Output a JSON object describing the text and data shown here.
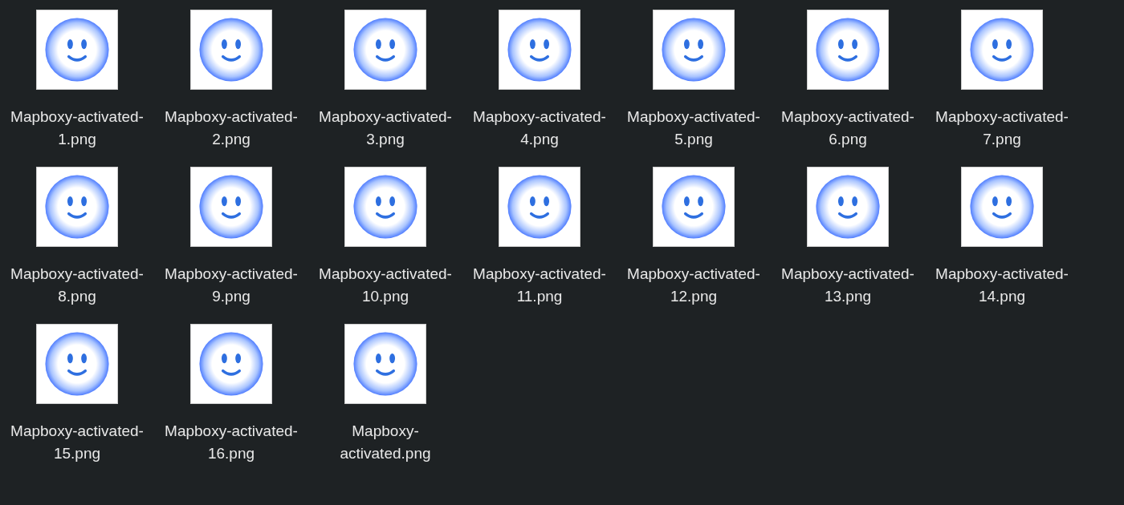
{
  "files": [
    {
      "name": "Mapboxy-activated-1.png"
    },
    {
      "name": "Mapboxy-activated-2.png"
    },
    {
      "name": "Mapboxy-activated-3.png"
    },
    {
      "name": "Mapboxy-activated-4.png"
    },
    {
      "name": "Mapboxy-activated-5.png"
    },
    {
      "name": "Mapboxy-activated-6.png"
    },
    {
      "name": "Mapboxy-activated-7.png"
    },
    {
      "name": "Mapboxy-activated-8.png"
    },
    {
      "name": "Mapboxy-activated-9.png"
    },
    {
      "name": "Mapboxy-activated-10.png"
    },
    {
      "name": "Mapboxy-activated-11.png"
    },
    {
      "name": "Mapboxy-activated-12.png"
    },
    {
      "name": "Mapboxy-activated-13.png"
    },
    {
      "name": "Mapboxy-activated-14.png"
    },
    {
      "name": "Mapboxy-activated-15.png"
    },
    {
      "name": "Mapboxy-activated-16.png"
    },
    {
      "name": "Mapboxy-activated.png"
    }
  ]
}
